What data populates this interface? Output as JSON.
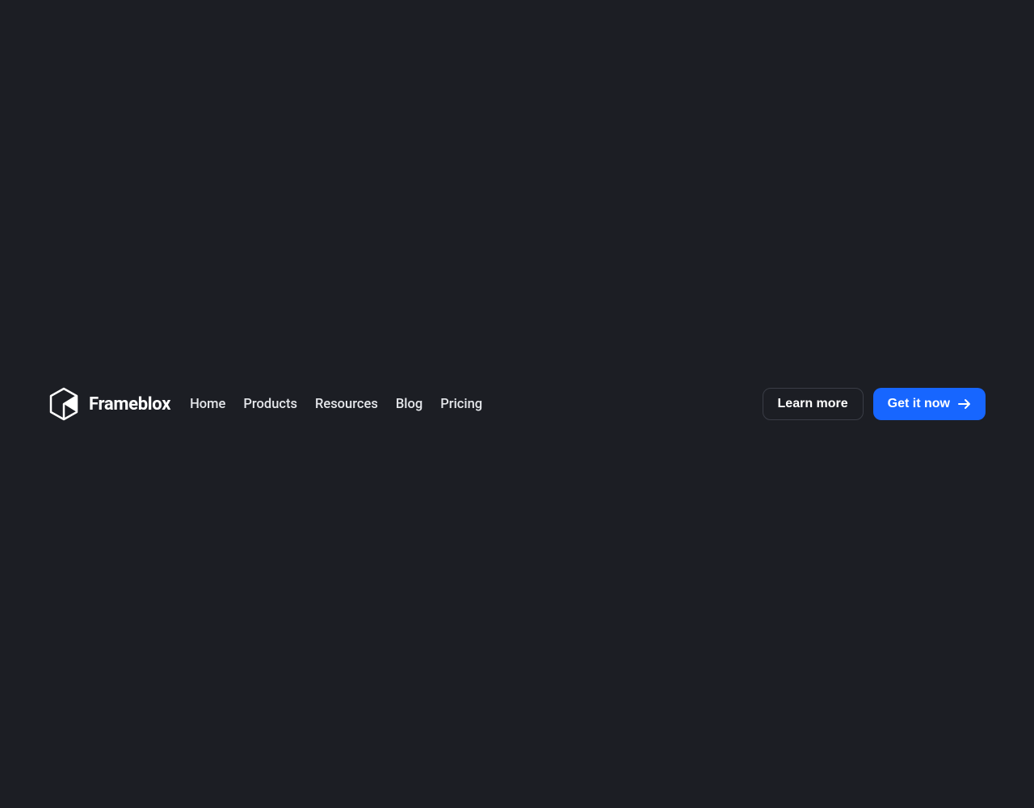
{
  "brand": {
    "name": "Frameblox"
  },
  "nav": {
    "items": [
      {
        "label": "Home"
      },
      {
        "label": "Products"
      },
      {
        "label": "Resources"
      },
      {
        "label": "Blog"
      },
      {
        "label": "Pricing"
      }
    ]
  },
  "actions": {
    "secondary_label": "Learn more",
    "primary_label": "Get it now"
  },
  "colors": {
    "background": "#1C1E24",
    "primary": "#1766FF",
    "text": "#FFFFFF",
    "border": "#3A3D46"
  }
}
